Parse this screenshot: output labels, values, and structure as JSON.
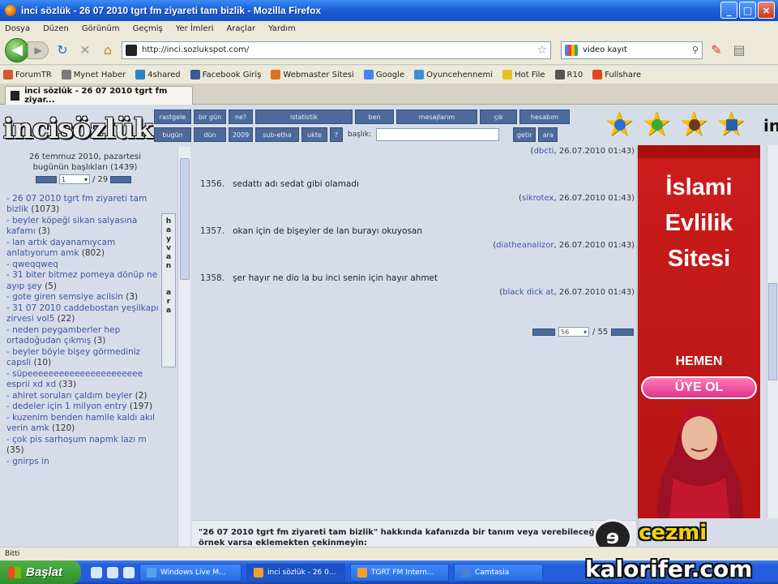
{
  "window": {
    "title": "inci sözlük - 26 07 2010 tgrt fm ziyareti tam bizlik - Mozilla Firefox",
    "buttons": {
      "minimize": "_",
      "maximize": "□",
      "close": "×"
    }
  },
  "menu": [
    "Dosya",
    "Düzen",
    "Görünüm",
    "Geçmiş",
    "Yer İmleri",
    "Araçlar",
    "Yardım"
  ],
  "navigation": {
    "url": "http://inci.sozlukspot.com/",
    "search_value": "video kayıt"
  },
  "bookmarks": [
    "ForumTR",
    "Mynet Haber",
    "4shared",
    "Facebook Giriş",
    "Webmaster Sitesi",
    "Google",
    "Oyuncehennemi",
    "Hot File",
    "R10",
    "Fullshare"
  ],
  "tab": {
    "label": "inci sözlük - 26 07 2010 tgrt fm ziyar..."
  },
  "site": {
    "logo": "incisözlük",
    "nav_row1": [
      "rastgele",
      "bir gün",
      "ne?",
      "istatistik",
      "ben",
      "mesajlarım",
      "çık",
      "hesabım"
    ],
    "nav_row2": [
      "bugün",
      "dün",
      "2009",
      "sub-etha",
      "ukte",
      "?"
    ],
    "search_label": "başlık:",
    "search_btn1": "getir",
    "search_btn2": "ara"
  },
  "sidebar": {
    "date_line1": "26 temmuz 2010, pazartesi",
    "date_line2": "bugünün başlıkları (1439)",
    "page_current": "1",
    "page_total": "/ 29",
    "vertical_tab": [
      "h",
      "a",
      "y",
      "v",
      "a",
      "n",
      "",
      "a",
      "r",
      "a"
    ],
    "topics": [
      {
        "title": "26 07 2010 tgrt fm ziyareti tam bizlik",
        "count": "(1073)"
      },
      {
        "title": "beyler köpeği sikan salyasına kafamı",
        "count": "(3)"
      },
      {
        "title": "lan artık dayanamıycam anlatıyorum amk",
        "count": "(802)"
      },
      {
        "title": "qweqqweq",
        "count": ""
      },
      {
        "title": "31 biter bitmez pomeya dönüp ne ayıp şey",
        "count": "(5)"
      },
      {
        "title": "gote giren semsiye acilsin",
        "count": "(3)"
      },
      {
        "title": "31 07 2010 caddebostan yeşilkapı zirvesi vol5",
        "count": "(22)"
      },
      {
        "title": "neden peygamberler hep ortadoğudan çıkmış",
        "count": "(3)"
      },
      {
        "title": "beyler böyle bişey görmediniz capsli",
        "count": "(10)"
      },
      {
        "title": "süpeeeeeeeeeeeeeeeeeeeeee esprii xd xd",
        "count": "(33)"
      },
      {
        "title": "ahiret soruları çaldım beyler",
        "count": "(2)"
      },
      {
        "title": "dedeler için 1 milyon entry",
        "count": "(197)"
      },
      {
        "title": "kuzenim benden hamile kaldı akıl verin amk",
        "count": "(120)"
      },
      {
        "title": "çok pis sarhoşum napmk lazı m",
        "count": "(35)"
      },
      {
        "title": "gnirps in",
        "count": ""
      }
    ]
  },
  "entries": {
    "top_meta": {
      "author": "dbcti",
      "date": "26.07.2010 01:43"
    },
    "items": [
      {
        "num": "1356.",
        "text": "sedattı adı sedat gibi olamadı",
        "author": "sikrotex",
        "date": "26.07.2010 01:43"
      },
      {
        "num": "1357.",
        "text": "okan için de bişeyler de lan burayı okuyosan",
        "author": "diatheanalizor",
        "date": "26.07.2010 01:43"
      },
      {
        "num": "1358.",
        "text": "şer hayır ne dio la bu inci senin için hayır ahmet",
        "author": "black dick at",
        "date": "26.07.2010 01:43"
      }
    ],
    "page_current": "56",
    "page_total": "/ 55",
    "define_text": "\"26 07 2010 tgrt fm ziyareti tam bizlik\" hakkında kafanızda bir tanım veya verebileceğiniz bir örnek varsa eklemekten çekinmeyin:"
  },
  "ad": {
    "line1": "İslami",
    "line2": "Evlilik",
    "line3": "Sitesi",
    "hemen": "HEMEN",
    "cta": "ÜYE OL"
  },
  "watermark": {
    "mark": "ɘ",
    "line1": "cezmi",
    "line2": "kalorifer.com"
  },
  "status": "Bitti",
  "taskbar": {
    "start": "Başlat",
    "tasks": [
      "Windows Live M...",
      "inci sözlük - 26 0...",
      "TGRT FM Intern...",
      "Camtasia"
    ]
  },
  "colors": {
    "nav_button": "#4c6a9b",
    "link": "#3c55a5",
    "ad_red": "#cc1d1d",
    "star": "#f5c400"
  }
}
